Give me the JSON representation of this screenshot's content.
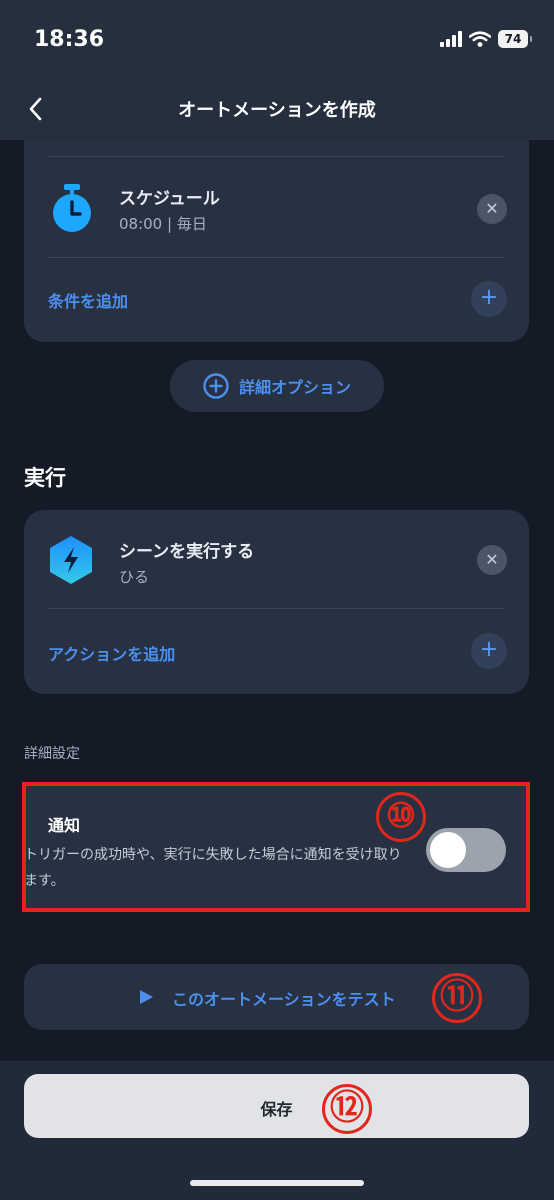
{
  "status_bar": {
    "time": "18:36",
    "battery": "74"
  },
  "nav": {
    "title": "オートメーションを作成"
  },
  "conditions": {
    "schedule": {
      "title": "スケジュール",
      "subtitle": "08:00 | 毎日"
    },
    "add_label": "条件を追加",
    "advanced_options_label": "詳細オプション"
  },
  "execution": {
    "section_title": "実行",
    "scene": {
      "title": "シーンを実行する",
      "subtitle": "ひる"
    },
    "add_label": "アクションを追加"
  },
  "advanced_settings": {
    "section_title": "詳細設定",
    "notification": {
      "title": "通知",
      "description": "トリガーの成功時や、実行に失敗した場合に通知を受け取ります。",
      "enabled": false
    }
  },
  "test_button": {
    "label": "このオートメーションをテスト"
  },
  "save_button": {
    "label": "保存"
  },
  "annotations": {
    "callout_10": "⑩",
    "callout_11": "⑪",
    "callout_12": "⑫"
  },
  "colors": {
    "accent": "#4b8ff0",
    "highlight": "#e2261b",
    "card": "#273142",
    "background": "#141b27"
  }
}
